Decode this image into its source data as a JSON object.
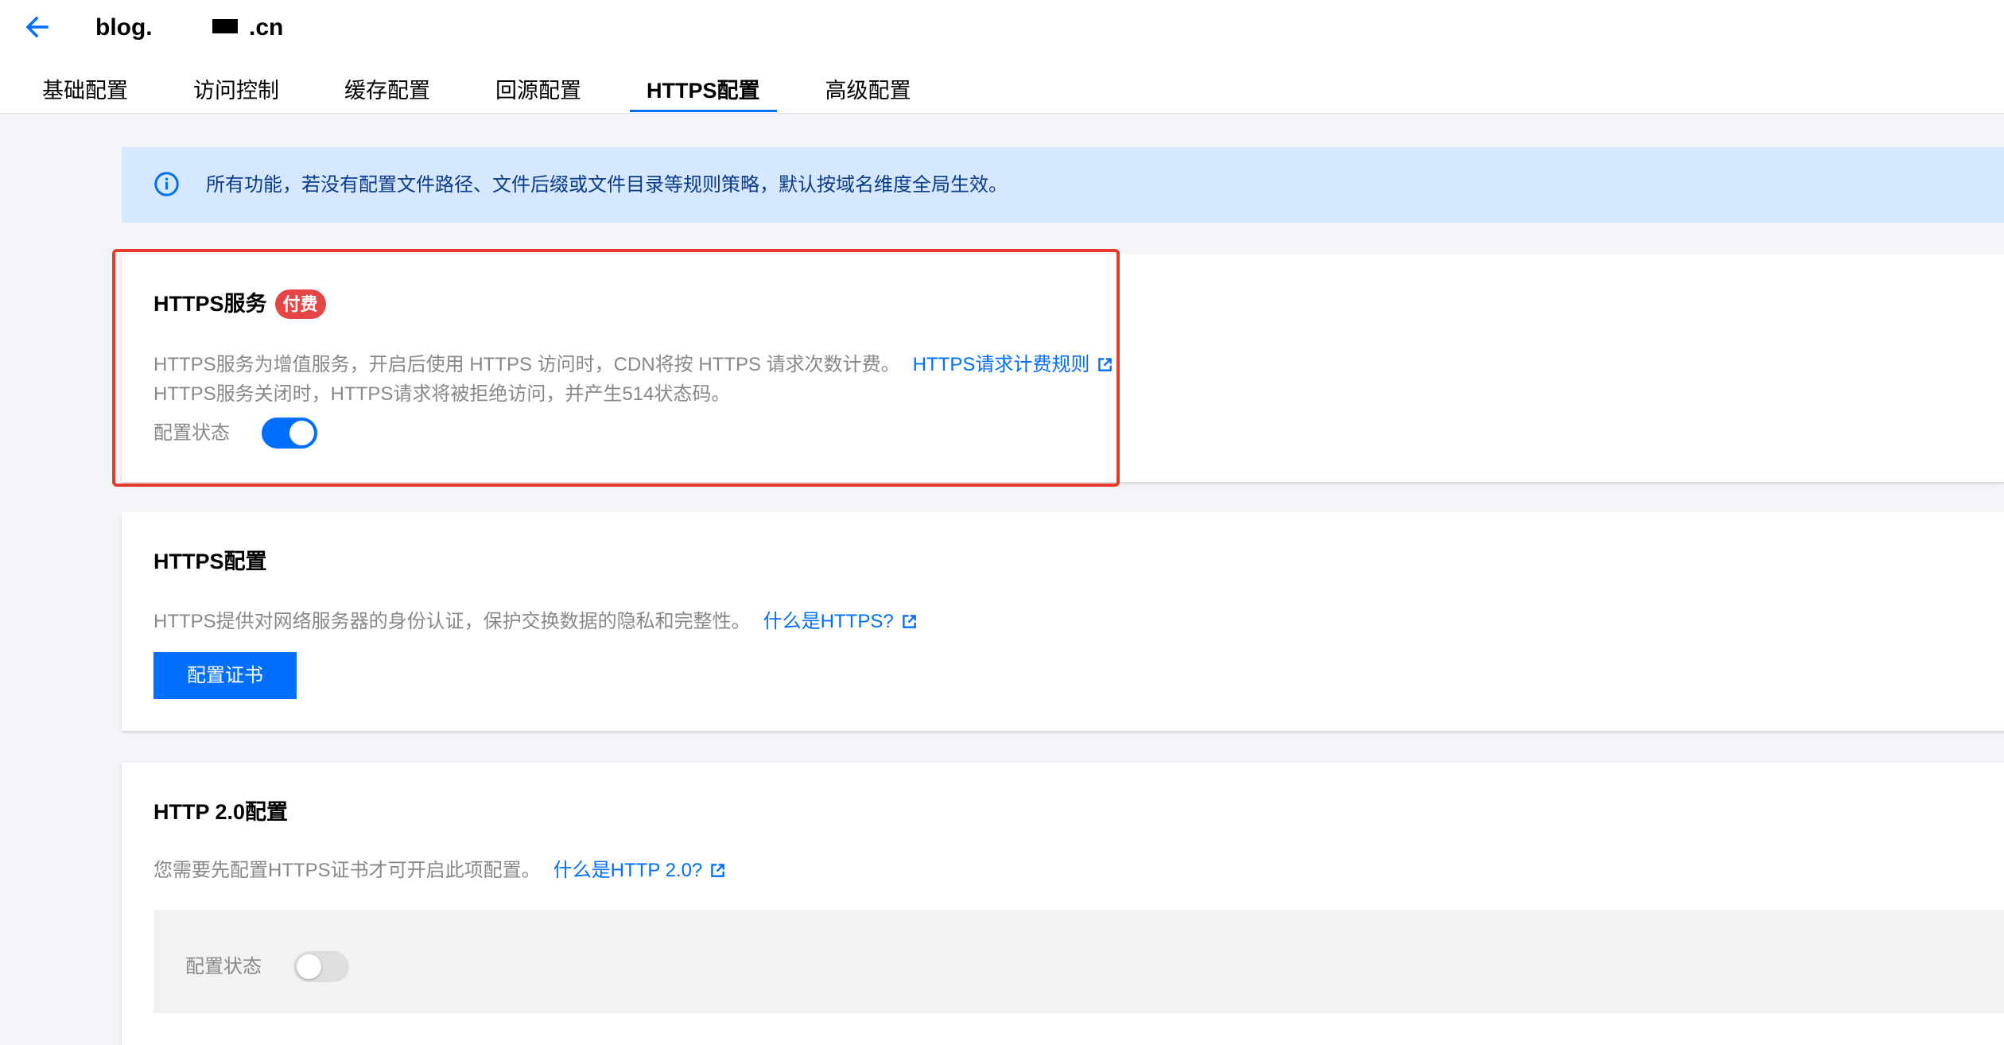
{
  "header": {
    "back_icon": "arrow-left-icon",
    "domain_prefix": "blog.",
    "domain_suffix": ".cn"
  },
  "tabs": [
    {
      "label": "基础配置",
      "active": false
    },
    {
      "label": "访问控制",
      "active": false
    },
    {
      "label": "缓存配置",
      "active": false
    },
    {
      "label": "回源配置",
      "active": false
    },
    {
      "label": "HTTPS配置",
      "active": true
    },
    {
      "label": "高级配置",
      "active": false
    }
  ],
  "notice": {
    "icon": "info-icon",
    "text": "所有功能，若没有配置文件路径、文件后缀或文件目录等规则策略，默认按域名维度全局生效。"
  },
  "https_service": {
    "title": "HTTPS服务",
    "badge": "付费",
    "description_line1": "HTTPS服务为增值服务，开启后使用 HTTPS 访问时，CDN将按 HTTPS 请求次数计费。",
    "link": "HTTPS请求计费规则",
    "link_icon": "external-link-icon",
    "description_line2": "HTTPS服务关闭时，HTTPS请求将被拒绝访问，并产生514状态码。",
    "status_label": "配置状态",
    "enabled": true
  },
  "https_config": {
    "title": "HTTPS配置",
    "description": "HTTPS提供对网络服务器的身份认证，保护交换数据的隐私和完整性。",
    "link": "什么是HTTPS?",
    "link_icon": "external-link-icon",
    "button_label": "配置证书"
  },
  "http2_config": {
    "title": "HTTP 2.0配置",
    "description": "您需要先配置HTTPS证书才可开启此项配置。",
    "link": "什么是HTTP 2.0?",
    "link_icon": "external-link-icon",
    "status_label": "配置状态",
    "enabled": false
  },
  "colors": {
    "primary": "#006eff",
    "badge": "#e54545",
    "highlight_border": "#e8392a",
    "notice_background": "#d5e8ff",
    "notice_text": "#0a3a8c",
    "page_background": "#f3f4f7"
  }
}
